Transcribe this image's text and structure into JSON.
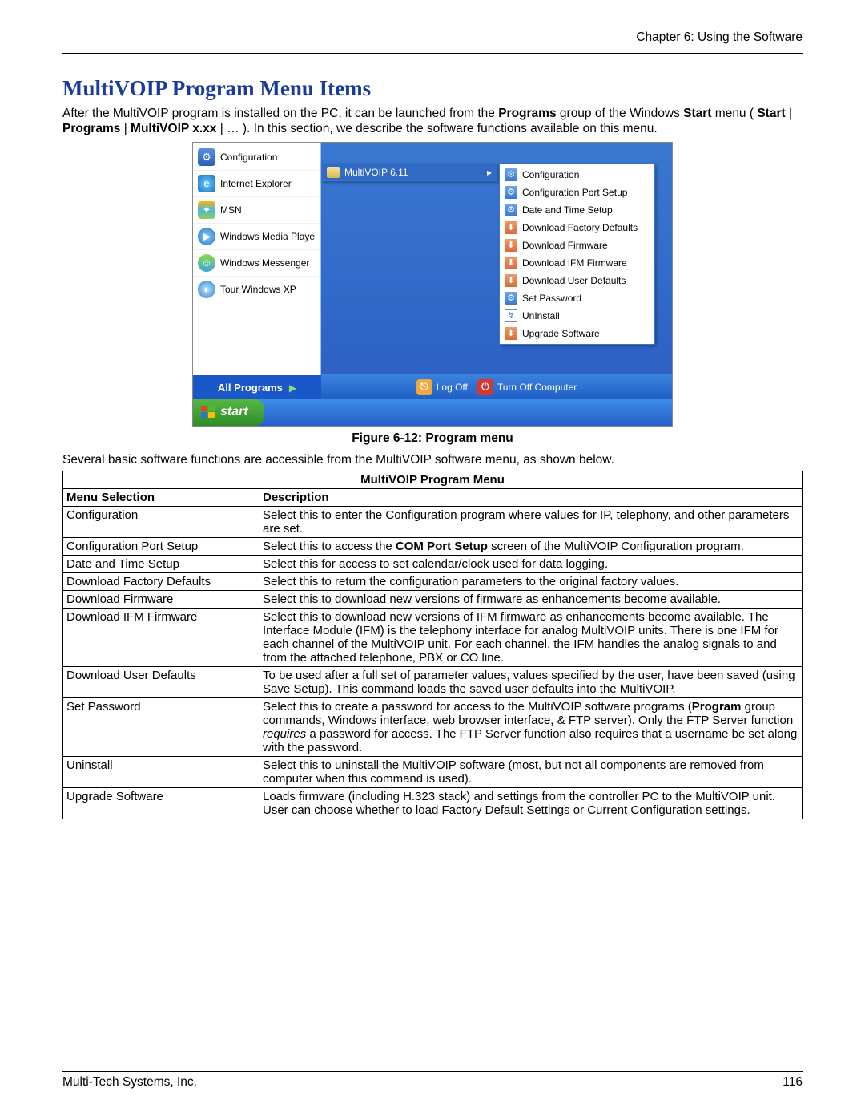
{
  "chapter_header": "Chapter 6: Using the Software",
  "title": "MultiVOIP Program Menu Items",
  "intro_prefix": "After the MultiVOIP program is installed on the PC, it can be launched from the ",
  "intro_programs_bold": "Programs",
  "intro_mid": " group of the Windows ",
  "intro_start_bold": "Start",
  "intro_menu_open": " menu ( ",
  "intro_b1": "Start",
  "intro_pipe": " | ",
  "intro_b2": "Programs",
  "intro_b3": "MultiVOIP x.xx",
  "intro_close": " | … ).  In this section, we describe the software functions available on this menu.",
  "start_items": {
    "config": "Configuration",
    "ie": "Internet Explorer",
    "msn": "MSN",
    "wmp": "Windows Media Playe",
    "msgr": "Windows Messenger",
    "tour": "Tour Windows XP"
  },
  "all_programs": "All Programs",
  "logoff": "Log Off",
  "turnoff": "Turn Off Computer",
  "start_btn": "start",
  "submenu1_label": "MultiVOIP 6.11",
  "submenu2": {
    "config": "Configuration",
    "portsetup": "Configuration Port Setup",
    "date": "Date and Time Setup",
    "factory": "Download Factory Defaults",
    "firmware": "Download Firmware",
    "ifm": "Download IFM Firmware",
    "userdef": "Download User Defaults",
    "setpass": "Set Password",
    "uninstall": "UnInstall",
    "upgrade": "Upgrade Software"
  },
  "figure_caption": "Figure 6-12: Program menu",
  "between_text": "Several basic software functions are accessible from the MultiVOIP software menu, as shown below.",
  "table_title": "MultiVOIP Program Menu",
  "col_menu": "Menu Selection",
  "col_desc": "Description",
  "rows": {
    "r1c1": "Configuration",
    "r1c2": "Select this to enter the Configuration program where values for IP, telephony, and other parameters are set.",
    "r2c1": "Configuration Port Setup",
    "r2c2a": "Select this to access the ",
    "r2c2b": "COM Port Setup",
    "r2c2c": " screen of the MultiVOIP Configuration program.",
    "r3c1": "Date and Time Setup",
    "r3c2": "Select this for access to set calendar/clock used for data logging.",
    "r4c1": "Download Factory Defaults",
    "r4c2": "Select this to return the configuration parameters to the original factory values.",
    "r5c1": "Download Firmware",
    "r5c2": "Select this to download new versions of firmware as enhancements become available.",
    "r6c1": "Download IFM Firmware",
    "r6c2": "Select this to download new versions of IFM firmware as enhancements become available. The Interface Module (IFM) is the telephony interface for analog MultiVOIP units.  There is one IFM for each channel of the MultiVOIP unit.  For each channel, the IFM handles the analog signals to and from the attached telephone, PBX or CO line.",
    "r7c1": "Download User Defaults",
    "r7c2": "To be used after a full set of parameter values, values specified by the user, have been saved (using Save Setup).  This command loads the saved user defaults into the MultiVOIP.",
    "r8c1": "Set Password",
    "r8c2a": "Select this to create a password for access to the MultiVOIP software programs (",
    "r8c2b": "Program",
    "r8c2c": " group commands, Windows interface, web browser interface, & FTP server).  Only the FTP Server function ",
    "r8c2d": "requires",
    "r8c2e": " a password for access.  The FTP Server function also requires that a username be set along with the password.",
    "r9c1": "Uninstall",
    "r9c2": "Select this to uninstall the MultiVOIP software (most, but not all components are removed from computer when this command is used).",
    "r10c1": "Upgrade Software",
    "r10c2": "Loads firmware (including H.323 stack) and settings from the controller PC to the MultiVOIP unit.  User can choose whether to load Factory Default Settings or Current Configuration settings."
  },
  "footer_left": "Multi-Tech Systems, Inc.",
  "footer_right": "116"
}
